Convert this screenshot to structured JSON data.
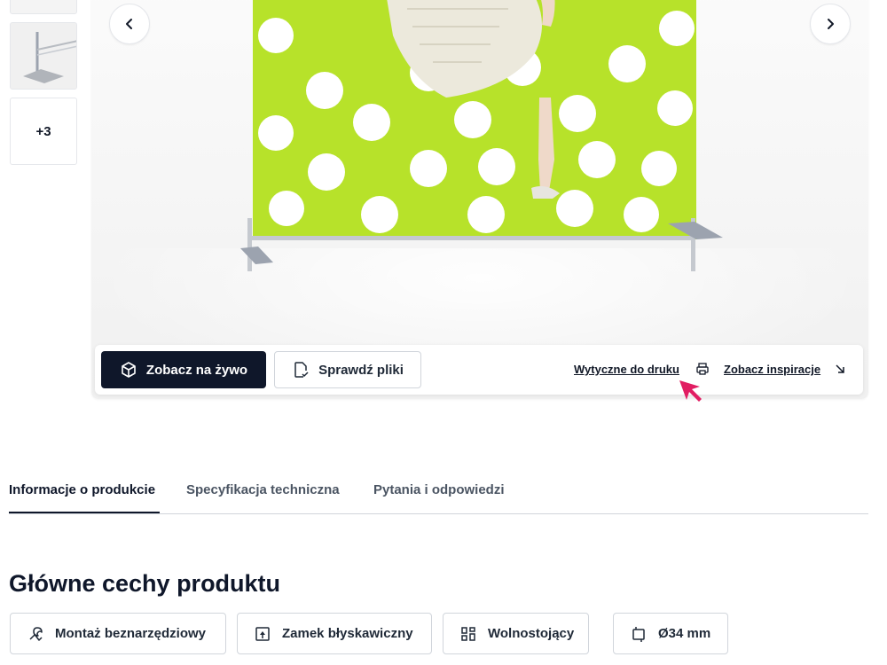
{
  "thumbnails": {
    "more_count": "+3"
  },
  "gallery": {
    "prev_icon": "chevron-left-icon",
    "next_icon": "chevron-right-icon",
    "banner_color": "#b7e22a"
  },
  "actions": {
    "live_view_label": "Zobacz na żywo",
    "check_files_label": "Sprawdź pliki",
    "print_guidelines_label": "Wytyczne do druku",
    "inspirations_label": "Zobacz inspiracje"
  },
  "tabs": [
    {
      "label": "Informacje o produkcie"
    },
    {
      "label": "Specyfikacja techniczna"
    },
    {
      "label": "Pytania i odpowiedzi"
    }
  ],
  "features": {
    "title": "Główne cechy produktu",
    "items": [
      {
        "label": "Montaż beznarzędziowy",
        "icon": "tool-free-icon"
      },
      {
        "label": "Zamek błyskawiczny",
        "icon": "zipper-icon"
      },
      {
        "label": "Wolnostojący",
        "icon": "freestanding-icon"
      },
      {
        "label": "Ø34 mm",
        "icon": "diameter-icon"
      }
    ]
  },
  "colors": {
    "dark": "#0f172a",
    "accent_cursor": "#e11d62"
  }
}
